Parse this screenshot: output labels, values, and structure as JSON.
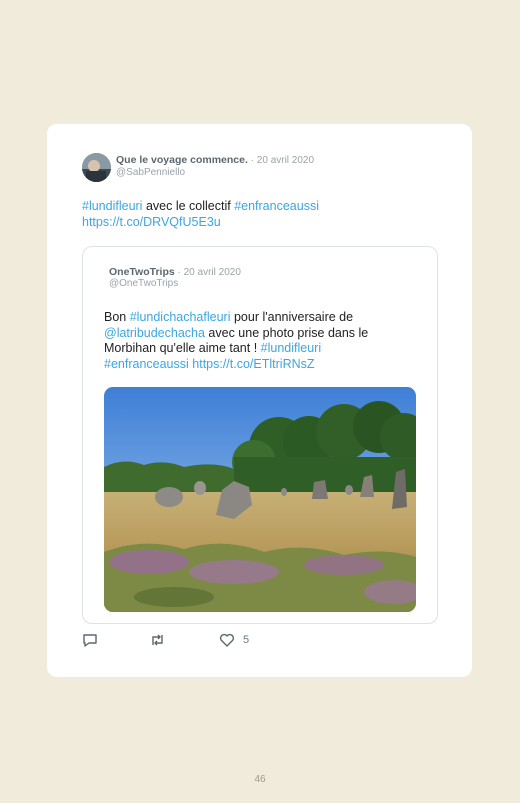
{
  "tweet": {
    "author_name": "Que le voyage commence.",
    "date": " · 20 avril 2020",
    "handle": "@SabPenniello",
    "text_parts": {
      "hashtag1": "#lundifleuri",
      "plain1": " avec le collectif ",
      "hashtag2": "#enfranceaussi",
      "link": "https://t.co/DRVQfU5E3u"
    }
  },
  "quoted": {
    "author_name": "OneTwoTrips",
    "date": " · 20 avril 2020",
    "handle": "@OneTwoTrips",
    "text_parts": {
      "plain1": "Bon ",
      "hashtag1": "#lundichachafleuri",
      "plain2": " pour l'anniversaire de ",
      "mention": "@latribudechacha",
      "plain3": " avec une photo prise dans le Morbihan qu'elle aime tant ! ",
      "hashtag2": "#lundifleuri",
      "hashtag3": "#enfranceaussi",
      "link": "https://t.co/ETltriRNsZ"
    }
  },
  "actions": {
    "reply_icon": "reply-icon",
    "retweet_icon": "retweet-icon",
    "like_icon": "heart-icon",
    "like_count": "5"
  },
  "page_number": "46",
  "colors": {
    "background": "#f1ebdb",
    "link": "#3ca6e0",
    "name": "#5b6770",
    "muted": "#9aa3aa"
  }
}
